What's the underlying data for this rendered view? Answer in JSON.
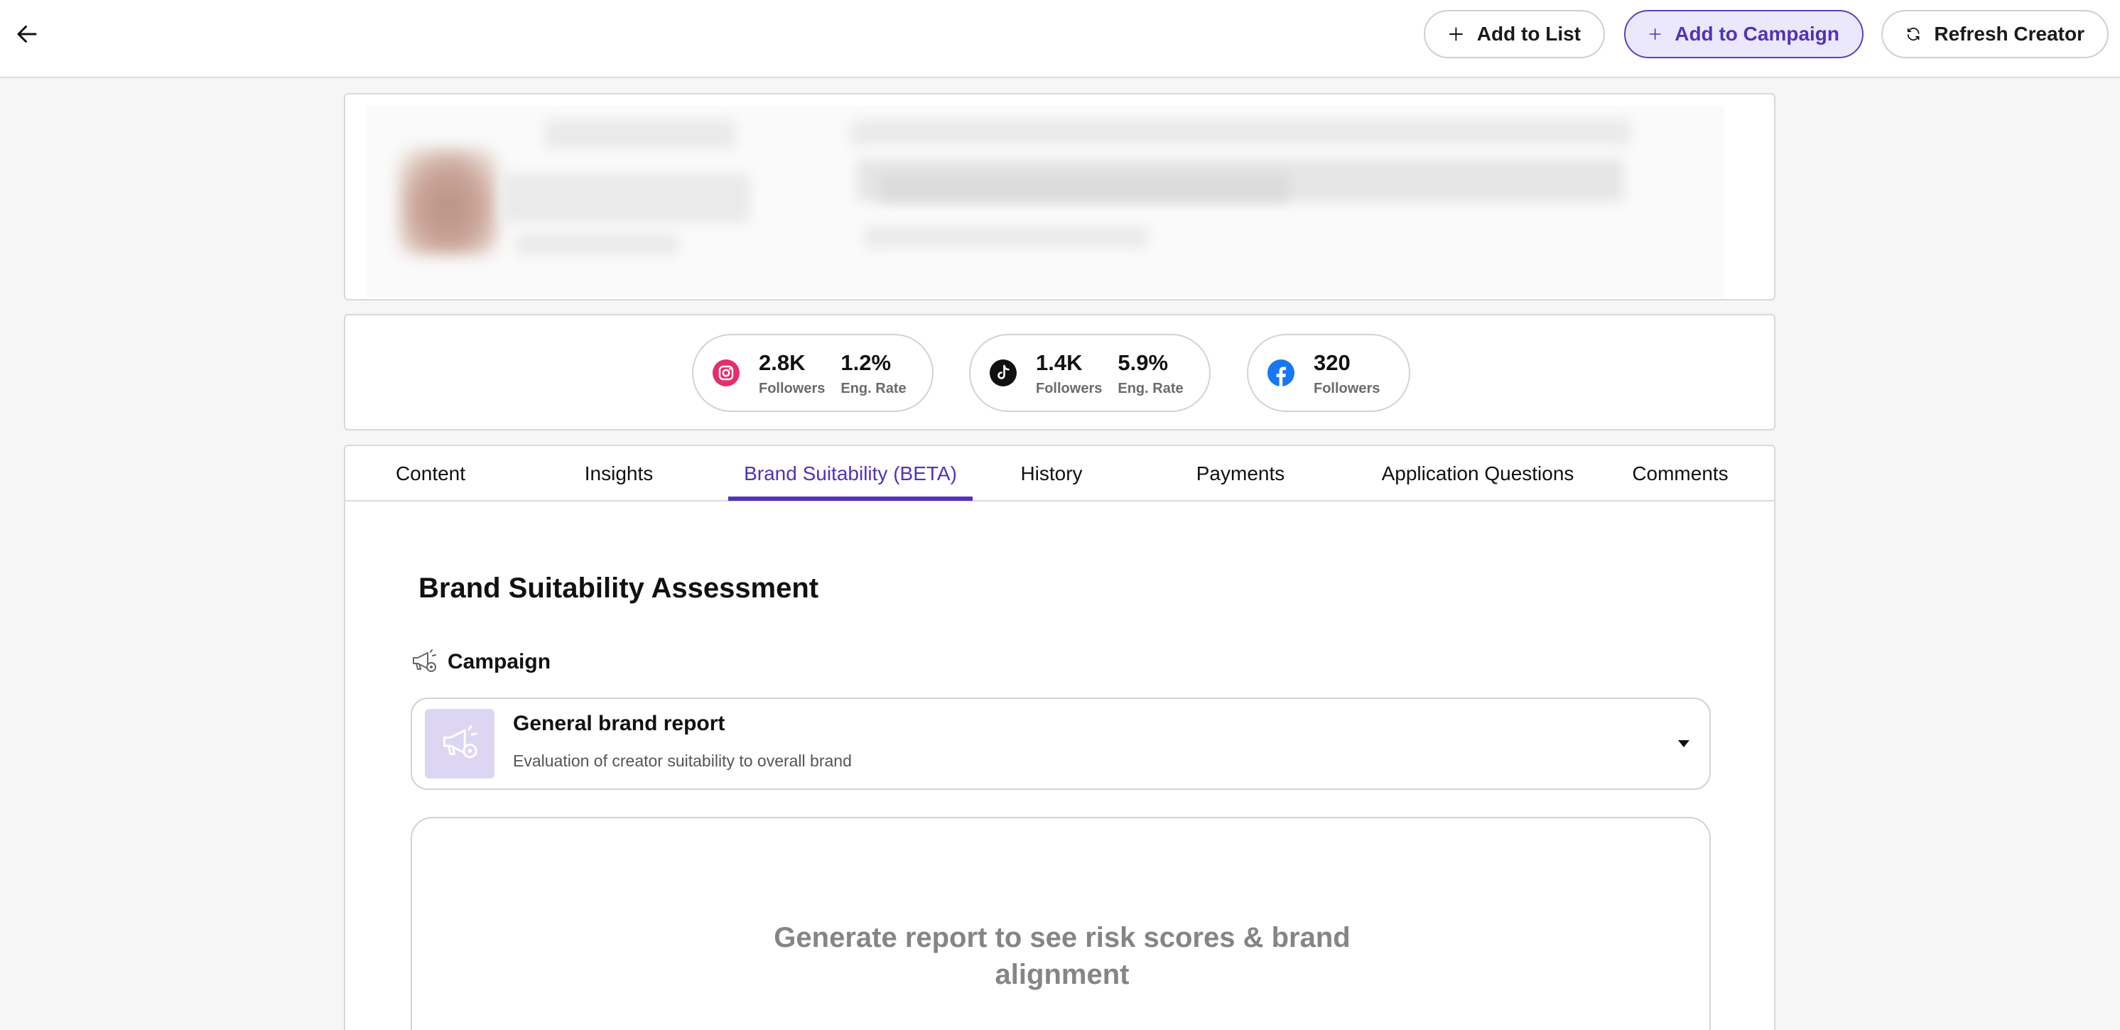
{
  "topbar": {
    "back_icon": "arrow-left-icon",
    "buttons": {
      "add_to_list": {
        "label": "Add to List",
        "icon": "plus-icon"
      },
      "add_to_campaign": {
        "label": "Add to Campaign",
        "icon": "plus-icon"
      },
      "refresh_creator": {
        "label": "Refresh Creator",
        "icon": "refresh-icon"
      }
    }
  },
  "stats": {
    "instagram": {
      "icon": "instagram-icon",
      "followers": "2.8K",
      "followers_label": "Followers",
      "eng_rate": "1.2%",
      "eng_rate_label": "Eng. Rate"
    },
    "tiktok": {
      "icon": "tiktok-icon",
      "followers": "1.4K",
      "followers_label": "Followers",
      "eng_rate": "5.9%",
      "eng_rate_label": "Eng. Rate"
    },
    "facebook": {
      "icon": "facebook-icon",
      "followers": "320",
      "followers_label": "Followers"
    }
  },
  "tabs": [
    "Content",
    "Insights",
    "Brand Suitability (BETA)",
    "History",
    "Payments",
    "Application Questions",
    "Comments"
  ],
  "active_tab": "Brand Suitability (BETA)",
  "assessment": {
    "title": "Brand Suitability Assessment",
    "campaign_label": "Campaign",
    "campaign_icon": "megaphone-gear-icon",
    "select": {
      "title": "General brand report",
      "subtitle": "Evaluation of creator suitability to overall brand"
    },
    "empty_message": "Generate report to see risk scores & brand alignment"
  },
  "colors": {
    "accent": "#5133b8",
    "accent_bg": "#ece8fb",
    "instagram": "#e1306c",
    "facebook": "#1877f2"
  }
}
